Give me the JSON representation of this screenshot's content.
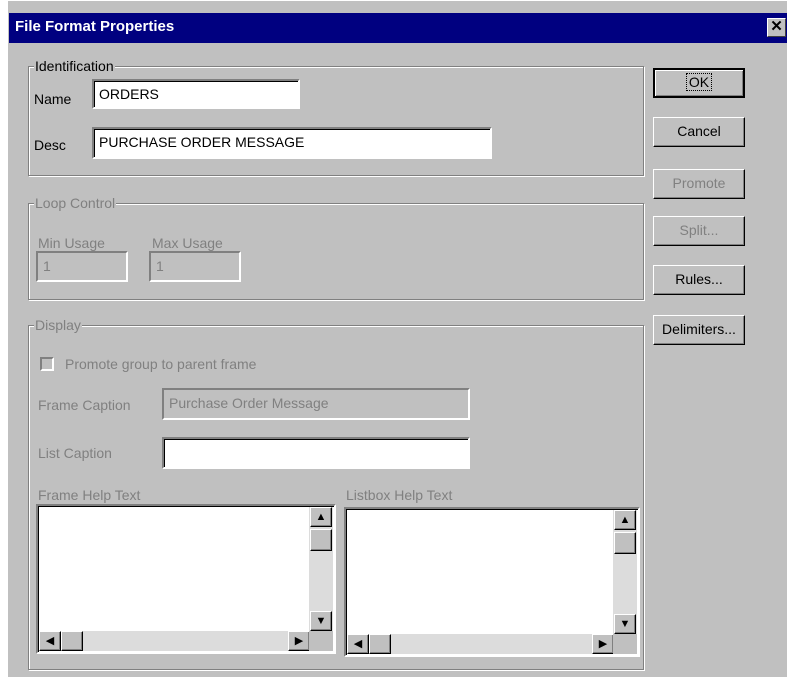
{
  "window": {
    "title": "File Format Properties",
    "close_glyph": "✕"
  },
  "identification": {
    "legend": "Identification",
    "name_label": "Name",
    "name_value": "ORDERS",
    "desc_label": "Desc",
    "desc_value": "PURCHASE ORDER MESSAGE"
  },
  "loop_control": {
    "legend": "Loop Control",
    "min_label": "Min Usage",
    "min_value": "1",
    "max_label": "Max Usage",
    "max_value": "1"
  },
  "display": {
    "legend": "Display",
    "promote_checkbox_label": "Promote group to parent frame",
    "frame_caption_label": "Frame Caption",
    "frame_caption_value": "Purchase Order Message",
    "list_caption_label": "List Caption",
    "list_caption_value": "",
    "frame_help_label": "Frame Help Text",
    "listbox_help_label": "Listbox Help Text"
  },
  "buttons": {
    "ok": "OK",
    "cancel": "Cancel",
    "promote": "Promote",
    "split": "Split...",
    "rules": "Rules...",
    "delimiters": "Delimiters..."
  },
  "scroll_glyphs": {
    "up": "▲",
    "down": "▼",
    "left": "◀",
    "right": "▶"
  }
}
